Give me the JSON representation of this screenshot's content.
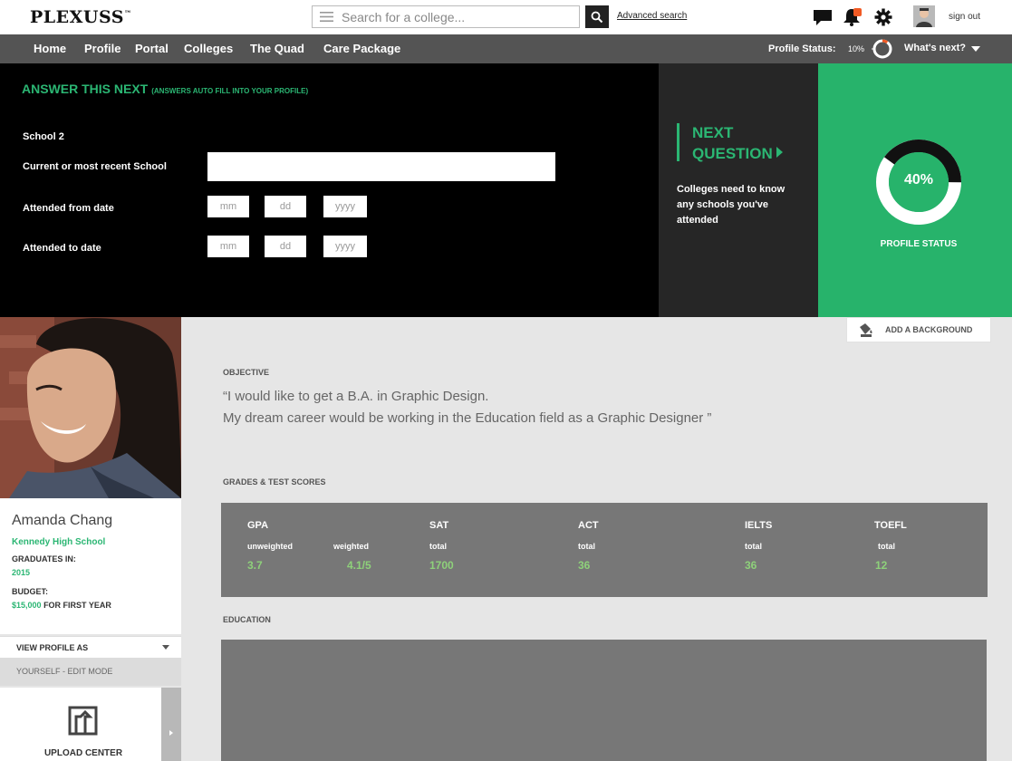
{
  "header": {
    "logo": "PLEXUSS",
    "logo_tm": "™",
    "search_placeholder": "Search for a college...",
    "advanced_search": "Advanced search",
    "notification_count": "1",
    "sign_out": "sign out"
  },
  "nav": {
    "items": [
      "Home",
      "Profile",
      "Portal",
      "Colleges",
      "The Quad",
      "Care Package"
    ],
    "profile_status_label": "Profile Status:",
    "profile_status_value": "10%",
    "profile_status_fraction": 0.1,
    "whats_next": "What's next?"
  },
  "answer_panel": {
    "title": "ANSWER THIS NEXT",
    "subtitle": "(ANSWERS AUTO FILL INTO YOUR PROFILE)",
    "section": "School 2",
    "school_label": "Current or most recent School",
    "school_value": "",
    "from_label": "Attended from date",
    "to_label": "Attended to date",
    "mm_placeholder": "mm",
    "dd_placeholder": "dd",
    "yyyy_placeholder": "yyyy"
  },
  "next_question": {
    "title_line1": "NEXT",
    "title_line2": "QUESTION",
    "description": "Colleges need to know any schools you've attended"
  },
  "status": {
    "percent_label": "40%",
    "fraction": 0.4,
    "caption": "PROFILE STATUS"
  },
  "profile": {
    "name": "Amanda Chang",
    "school": "Kennedy High School",
    "graduates_label": "GRADUATES IN:",
    "graduates_year": "2015",
    "budget_label": "BUDGET:",
    "budget_amount": "$15,000",
    "budget_suffix": "FOR FIRST YEAR",
    "view_profile_as": "VIEW PROFILE AS",
    "view_mode": "YOURSELF - EDIT MODE",
    "upload_center": "UPLOAD CENTER"
  },
  "main": {
    "add_background": "ADD A BACKGROUND",
    "objective_label": "OBJECTIVE",
    "objective_line1": "“I would like to get a B.A.  in  Graphic Design.",
    "objective_line2": "My dream career would be working in the Education field as a  Graphic Designer ”",
    "grades_label": "GRADES & TEST SCORES",
    "education_label": "EDUCATION",
    "scores": {
      "gpa": "GPA",
      "unweighted_label": "unweighted",
      "weighted_label": "weighted",
      "unweighted": "3.7",
      "weighted": "4.1/5",
      "sat": "SAT",
      "sat_sub": "total",
      "sat_val": "1700",
      "act": "ACT",
      "act_sub": "total",
      "act_val": "36",
      "ielts": "IELTS",
      "ielts_sub": "total",
      "ielts_val": "36",
      "toefl": "TOEFL",
      "toefl_sub": "total",
      "toefl_val": "12"
    }
  },
  "colors": {
    "brand_green": "#2bb673",
    "nav_gray": "#545454",
    "accent_orange": "#f15a24",
    "score_green": "#8ed17a"
  },
  "icons": [
    "menu-icon",
    "search-icon",
    "chat-icon",
    "bell-icon",
    "gear-icon",
    "user-avatar",
    "paint-bucket-icon",
    "upload-icon",
    "chevron-down-icon",
    "arrow-right-icon"
  ]
}
